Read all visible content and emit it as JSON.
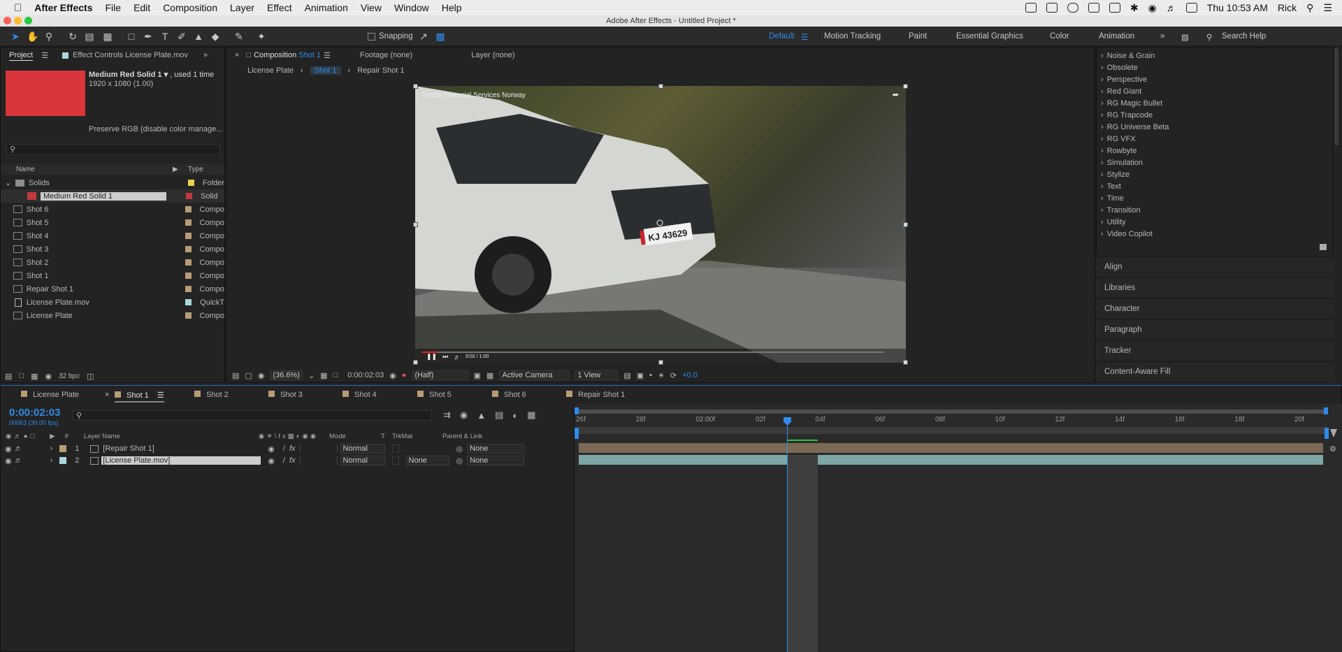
{
  "menubar": {
    "app_name": "After Effects",
    "items": [
      "File",
      "Edit",
      "Composition",
      "Layer",
      "Effect",
      "Animation",
      "View",
      "Window",
      "Help"
    ],
    "clock": "Thu 10:53 AM",
    "user": "Rick"
  },
  "window_title": "Adobe After Effects - Untitled Project *",
  "toolbar": {
    "snapping_label": "Snapping",
    "workspaces": [
      "Default",
      "Motion Tracking",
      "Paint",
      "Essential Graphics",
      "Color",
      "Animation"
    ],
    "search_placeholder": "Search Help"
  },
  "project_panel": {
    "tab_label": "Project",
    "effect_controls_tab": "Effect Controls License Plate.mov",
    "preview_color": "#d9363b",
    "item_name": "Medium Red Solid 1",
    "item_usage": ", used 1 time",
    "item_dims": "1920 x 1080 (1.00)",
    "preserve_rgb": "Preserve RGB (disable color manage...",
    "col_name": "Name",
    "col_type": "Type",
    "bpc": "32 bpc",
    "items": [
      {
        "name": "Solids",
        "type": "Folder",
        "color": "#e6d24d",
        "kind": "folder"
      },
      {
        "name": "Medium Red Solid 1",
        "type": "Solid",
        "color": "#c0393d",
        "kind": "solid"
      },
      {
        "name": "Shot 6",
        "type": "Compo",
        "color": "#b89c76",
        "kind": "comp"
      },
      {
        "name": "Shot 5",
        "type": "Compo",
        "color": "#b89c76",
        "kind": "comp"
      },
      {
        "name": "Shot 4",
        "type": "Compo",
        "color": "#b89c76",
        "kind": "comp"
      },
      {
        "name": "Shot 3",
        "type": "Compo",
        "color": "#b89c76",
        "kind": "comp"
      },
      {
        "name": "Shot 2",
        "type": "Compo",
        "color": "#b89c76",
        "kind": "comp"
      },
      {
        "name": "Shot 1",
        "type": "Compo",
        "color": "#b89c76",
        "kind": "comp"
      },
      {
        "name": "Repair Shot 1",
        "type": "Compo",
        "color": "#b89c76",
        "kind": "comp"
      },
      {
        "name": "License Plate.mov",
        "type": "QuickT",
        "color": "#a8d7dd",
        "kind": "footage"
      },
      {
        "name": "License Plate",
        "type": "Compo",
        "color": "#b89c76",
        "kind": "comp"
      }
    ]
  },
  "viewer": {
    "tab_prefix": "Composition",
    "tab_comp": "Shot 1",
    "footage_tab": "Footage (none)",
    "layer_tab": "Layer (none)",
    "breadcrumb": [
      "License Plate",
      "Shot 1",
      "Repair Shot 1"
    ],
    "video_caption": "Toyota Financial Services Norway",
    "plate_text": "KJ 43629",
    "player_time": "0:02 / 1:00",
    "zoom": "(36.6%)",
    "timecode": "0:00:02:03",
    "resolution": "(Half)",
    "camera": "Active Camera",
    "views": "1 View",
    "exposure": "+0.0"
  },
  "effects_list": [
    "Noise & Grain",
    "Obsolete",
    "Perspective",
    "Red Giant",
    "RG Magic Bullet",
    "RG Trapcode",
    "RG Universe Beta",
    "RG VFX",
    "Rowbyte",
    "Simulation",
    "Stylize",
    "Text",
    "Time",
    "Transition",
    "Utility",
    "Video Copilot"
  ],
  "side_panels": [
    "Align",
    "Libraries",
    "Character",
    "Paragraph",
    "Tracker",
    "Content-Aware Fill"
  ],
  "timeline": {
    "tabs": [
      "License Plate",
      "Shot 1",
      "Shot 2",
      "Shot 3",
      "Shot 4",
      "Shot 5",
      "Shot 6",
      "Repair Shot 1"
    ],
    "current_time": "0:00:02:03",
    "frame_info": "00063 (30.00 fps)",
    "headers": {
      "num": "#",
      "layer_name": "Layer Name",
      "mode": "Mode",
      "t": "T",
      "trkmat": "TrkMat",
      "parent": "Parent & Link"
    },
    "ruler_labels": [
      "26f",
      "28f",
      "02:00f",
      "02f",
      "04f",
      "06f",
      "08f",
      "10f",
      "12f",
      "14f",
      "16f",
      "18f",
      "20f"
    ],
    "layers": [
      {
        "num": "1",
        "name": "[Repair Shot 1]",
        "mode": "Normal",
        "trkmat": "",
        "parent": "None",
        "color": "#b89c76"
      },
      {
        "num": "2",
        "name": "[License Plate.mov]",
        "mode": "Normal",
        "trkmat": "None",
        "parent": "None",
        "color": "#a8d7dd"
      }
    ]
  }
}
